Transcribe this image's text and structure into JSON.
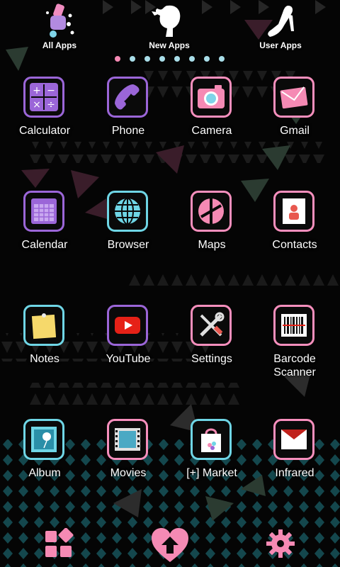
{
  "top_tabs": [
    {
      "label": "All Apps",
      "icon": "nail-polish-icon"
    },
    {
      "label": "New Apps",
      "icon": "woman-silhouette-icon"
    },
    {
      "label": "User Apps",
      "icon": "high-heel-shoe-icon"
    }
  ],
  "page_indicator": {
    "count": 8,
    "active_index": 0
  },
  "apps": [
    {
      "label": "Calculator",
      "icon": "calculator-icon"
    },
    {
      "label": "Phone",
      "icon": "phone-handset-icon"
    },
    {
      "label": "Camera",
      "icon": "camera-icon"
    },
    {
      "label": "Gmail",
      "icon": "envelope-icon"
    },
    {
      "label": "Calendar",
      "icon": "calendar-icon"
    },
    {
      "label": "Browser",
      "icon": "globe-icon"
    },
    {
      "label": "Maps",
      "icon": "map-pin-icon"
    },
    {
      "label": "Contacts",
      "icon": "contact-card-icon"
    },
    {
      "label": "Notes",
      "icon": "sticky-note-icon"
    },
    {
      "label": "YouTube",
      "icon": "play-button-icon"
    },
    {
      "label": "Settings",
      "icon": "tools-icon"
    },
    {
      "label": "Barcode Scanner",
      "icon": "barcode-icon"
    },
    {
      "label": "Album",
      "icon": "photo-icon"
    },
    {
      "label": "Movies",
      "icon": "film-icon"
    },
    {
      "label": "[+] Market",
      "icon": "shopping-bag-icon"
    },
    {
      "label": "Infrared",
      "icon": "infrared-envelope-icon"
    }
  ],
  "dock": [
    {
      "icon": "app-drawer-icon"
    },
    {
      "icon": "heart-home-icon"
    },
    {
      "icon": "gear-icon"
    }
  ],
  "colors": {
    "pink": "#f58ab4",
    "purple": "#9b66d8",
    "cyan": "#6fd6e6",
    "background": "#050505"
  }
}
